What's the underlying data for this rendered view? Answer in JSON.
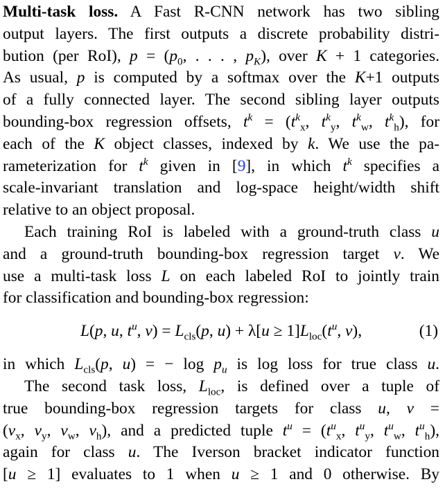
{
  "lines": [
    "Multi-task loss.",
    " A Fast R-CNN network has two sibling",
    "output layers. The first outputs a discrete probability distri-",
    "bution (per RoI), p = (p0, . . . , pK), over K + 1 categories.",
    "As usual, p is computed by a softmax over the K+1 outputs",
    "of a fully connected layer. The second sibling layer outputs",
    "bounding-box regression offsets, tk = (tkx, tky, tkw, tkh), for",
    "each of the K object classes, indexed by k. We use the pa-",
    "rameterization for tk given in [9], in which tk specifies a",
    "scale-invariant translation and log-space height/width shift",
    "relative to an object proposal.",
    "Each training RoI is labeled with a ground-truth class u",
    "and a ground-truth bounding-box regression target v. We",
    "use a multi-task loss L on each labeled RoI to jointly train",
    "for classification and bounding-box regression:",
    "L(p, u, tu, v) = Lcls(p, u) + λ[u ≥ 1]Lloc(tu, v),",
    "(1)",
    "in which Lcls(p, u) = − log pu is log loss for true class u.",
    "The second task loss, Lloc, is defined over a tuple of",
    "true bounding-box regression targets for class u, v =",
    "(vx, vy, vw, vh), and a predicted tuple tu = (tux, tuy, tuw, tuh),",
    "again for class u. The Iverson bracket indicator function",
    "[u ≥ 1] evaluates to 1 when u ≥ 1 and 0 otherwise. By"
  ],
  "citation": "9"
}
